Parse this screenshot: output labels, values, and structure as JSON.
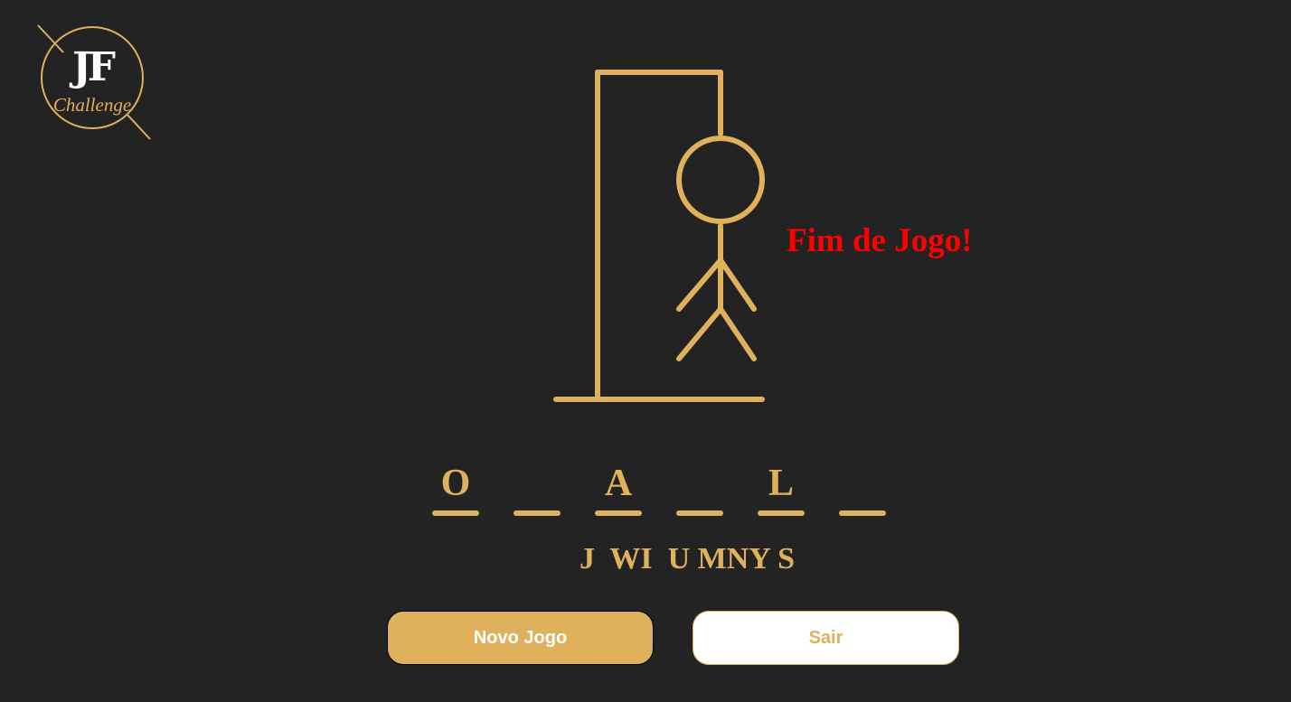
{
  "logo": {
    "title": "JF",
    "subtitle": "Challenge"
  },
  "game": {
    "status": "Fim de Jogo!",
    "word_slots": [
      "O",
      "",
      "A",
      "",
      "L",
      ""
    ],
    "wrong_letters": "J  WI  U MNY S"
  },
  "buttons": {
    "new_game": "Novo Jogo",
    "exit": "Sair"
  },
  "colors": {
    "background": "#232323",
    "accent": "#e0b15c",
    "game_over": "#ff0000",
    "button_text_light": "#ffffff"
  }
}
